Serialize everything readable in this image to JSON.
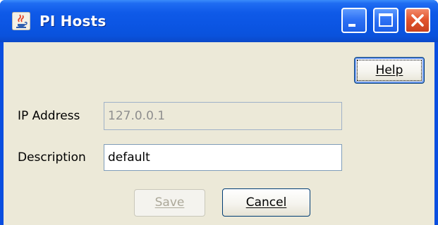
{
  "window": {
    "title": "PI Hosts",
    "icon": "java-cup-icon"
  },
  "titlebar_buttons": {
    "minimize": "minimize-icon",
    "maximize": "maximize-icon",
    "close": "close-icon"
  },
  "help_button": {
    "label": "Help",
    "mnemonic": "H"
  },
  "form": {
    "ip_label": "IP Address",
    "ip_value": "127.0.0.1",
    "ip_enabled": false,
    "description_label": "Description",
    "description_value": "default"
  },
  "save_button": {
    "label": "Save",
    "mnemonic": "S",
    "enabled": false
  },
  "cancel_button": {
    "label": "Cancel",
    "mnemonic": "C"
  },
  "colors": {
    "titlebar": "#0b55e3",
    "dialog_bg": "#ece9d8",
    "close_button": "#e3562f",
    "disabled_text": "#aca899"
  }
}
